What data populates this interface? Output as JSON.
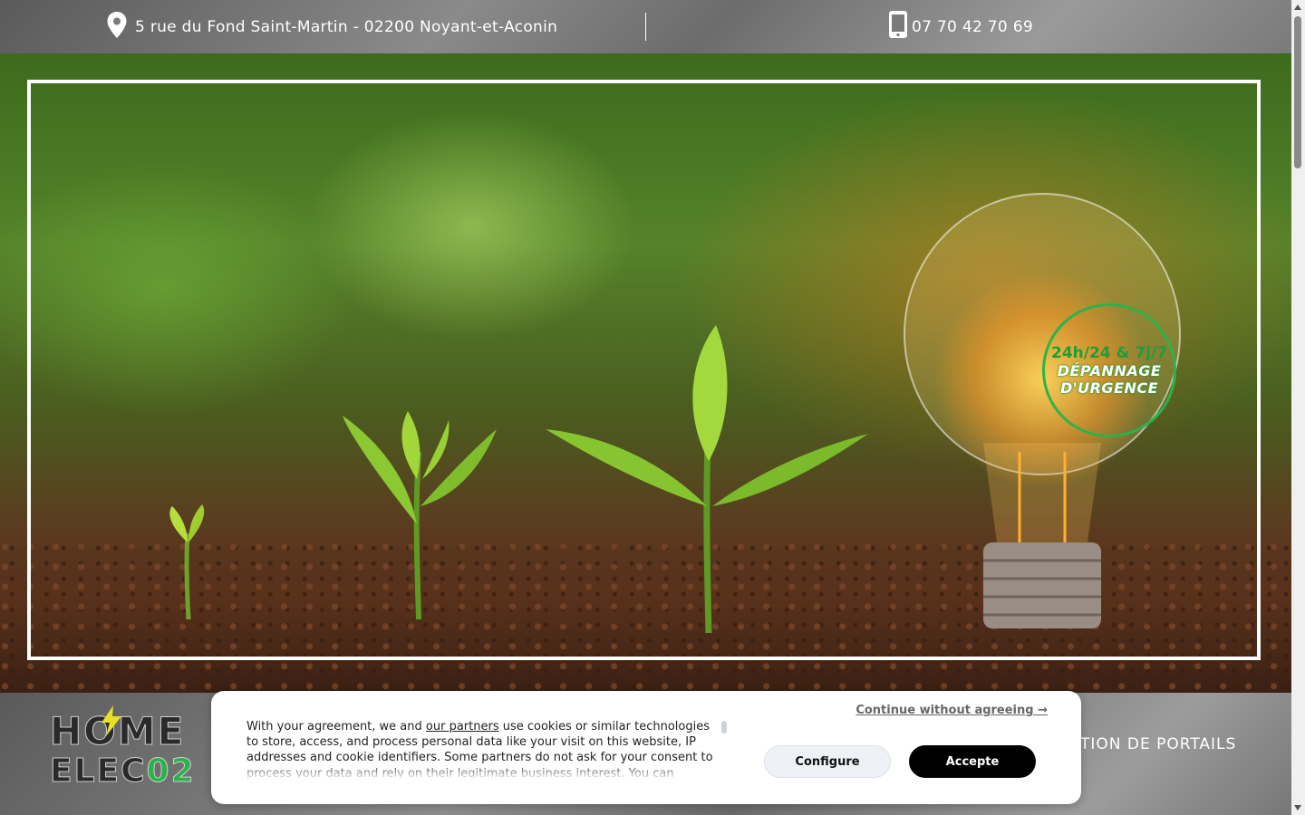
{
  "topbar": {
    "address": "5 rue du Fond Saint-Martin - 02200 Noyant-et-Aconin",
    "phone": "07 70 42 70 69",
    "address_icon": "map-pin-icon",
    "phone_icon": "smartphone-icon"
  },
  "hero": {
    "badge": {
      "line1": "24h/24 & 7j/7",
      "line2": "DÉPANNAGE",
      "line3": "D'URGENCE"
    }
  },
  "nav": {
    "logo_line1": "HOME",
    "logo_line2_a": "ELEC",
    "logo_line2_b": "02",
    "visible_link": "TION DE PORTAILS"
  },
  "cookie": {
    "text_before": "With your agreement, we and ",
    "partners_link": "our partners",
    "text_after": " use cookies or similar technologies to store, access, and process personal data like your visit on this website, IP addresses and cookie identifiers. Some partners do not ask for your consent to process your data and rely on their legitimate business interest. You can",
    "continue_label": "Continue without agreeing →",
    "configure_label": "Configure",
    "accept_label": "Accepte"
  },
  "colors": {
    "brand_green": "#2bb34a",
    "accept_bg": "#000000",
    "topbar_gray": "#7a7a7a"
  }
}
